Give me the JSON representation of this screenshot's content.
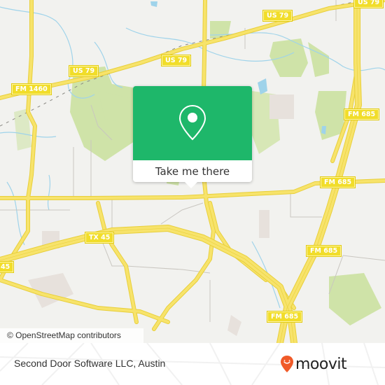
{
  "map": {
    "road_labels": [
      {
        "id": "us79-a",
        "text": "US 79"
      },
      {
        "id": "us79-b",
        "text": "US 79"
      },
      {
        "id": "us79-c",
        "text": "US 79"
      },
      {
        "id": "fm1460",
        "text": "FM 1460"
      },
      {
        "id": "fm685-a",
        "text": "FM 685"
      },
      {
        "id": "fm685-b",
        "text": "FM 685"
      },
      {
        "id": "fm685-c",
        "text": "FM 685"
      },
      {
        "id": "fm685-d",
        "text": "FM 685"
      },
      {
        "id": "tx45-a",
        "text": "TX 45"
      },
      {
        "id": "tx45-b",
        "text": "45"
      }
    ],
    "colors": {
      "background": "#f2f2ef",
      "road": "#f7e36b",
      "road_casing": "#e8cf3a",
      "park": "#cfe3a8",
      "water": "#9fd3ea",
      "minor_road": "#c9c6c0"
    },
    "attribution": "© OpenStreetMap contributors"
  },
  "popup": {
    "icon": "map-pin-icon",
    "cta_label": "Take me there",
    "accent_color": "#1eb76a"
  },
  "footer": {
    "place_name": "Second Door Software LLC, Austin",
    "brand": "moovit",
    "brand_color": "#f05a28"
  }
}
